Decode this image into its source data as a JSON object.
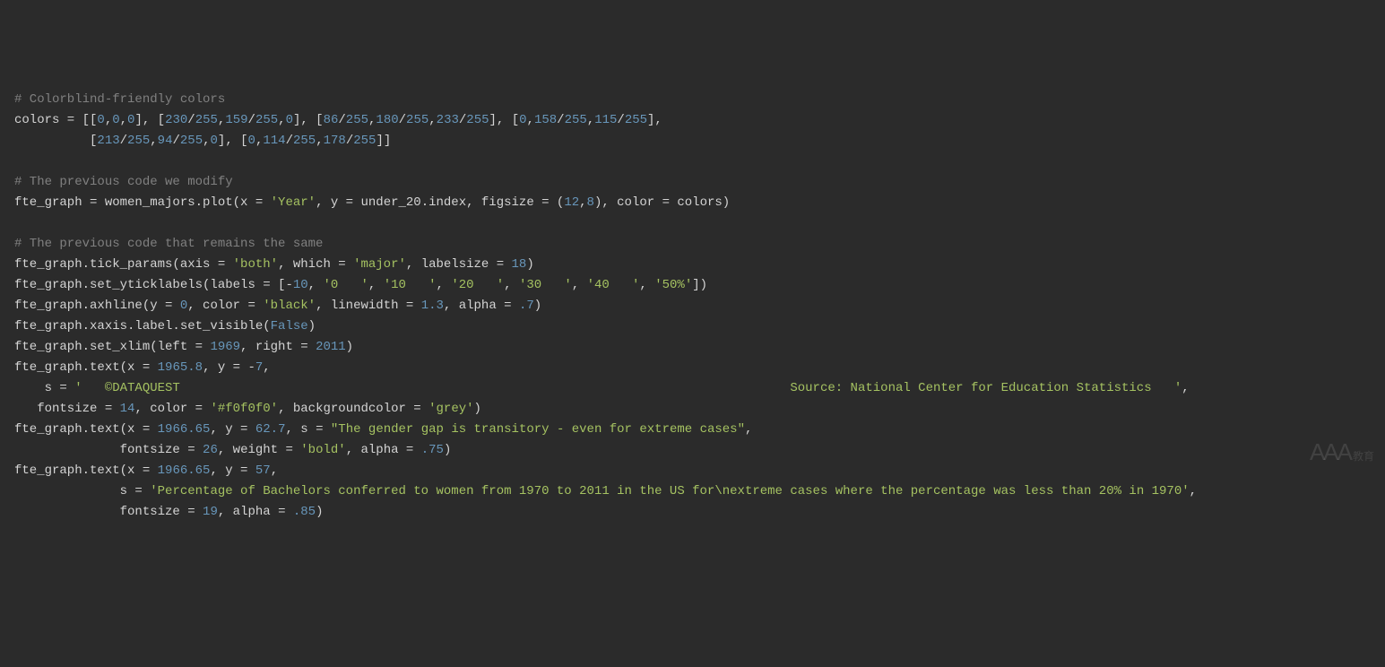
{
  "code": {
    "lines": [
      {
        "type": "comment",
        "text": "# Colorblind-friendly colors"
      },
      {
        "type": "colors_line1",
        "prefix": "colors = [[",
        "n0a": "0",
        "c": ",",
        "n0b": "0",
        "n0c": "0",
        "close": "], [",
        "n1a": "230",
        "slash": "/",
        "n255": "255",
        "n1b": "159",
        "n1c": "0",
        "n2a": "86",
        "n2b": "180",
        "n2c": "233",
        "n3a": "0",
        "n3b": "158",
        "n3c": "115",
        "tail": "],"
      },
      {
        "type": "colors_line2",
        "pad": "          [",
        "n4a": "213",
        "n4b": "94",
        "n4c": "0",
        "n5a": "0",
        "n5b": "114",
        "n5c": "178",
        "tail": "]]"
      },
      {
        "type": "blank"
      },
      {
        "type": "comment",
        "text": "# The previous code we modify"
      },
      {
        "type": "plot_line",
        "prefix": "fte_graph = women_majors.plot(x = ",
        "s1": "'Year'",
        "mid1": ", y = under_20.index, figsize = (",
        "n1": "12",
        "c": ",",
        "n2": "8",
        "mid2": "), color = colors)"
      },
      {
        "type": "blank"
      },
      {
        "type": "comment",
        "text": "# The previous code that remains the same"
      },
      {
        "type": "tick_params",
        "prefix": "fte_graph.tick_params(axis = ",
        "s1": "'both'",
        "mid1": ", which = ",
        "s2": "'major'",
        "mid2": ", labelsize = ",
        "n1": "18",
        "tail": ")"
      },
      {
        "type": "yticklabels",
        "prefix": "fte_graph.set_yticklabels(labels = [-",
        "n0": "10",
        "c": ", ",
        "s1": "'0   '",
        "s2": "'10   '",
        "s3": "'20   '",
        "s4": "'30   '",
        "s5": "'40   '",
        "s6": "'50%'",
        "tail": "])"
      },
      {
        "type": "axhline",
        "prefix": "fte_graph.axhline(y = ",
        "n1": "0",
        "mid1": ", color = ",
        "s1": "'black'",
        "mid2": ", linewidth = ",
        "n2": "1.3",
        "mid3": ", alpha = ",
        "n3": ".7",
        "tail": ")"
      },
      {
        "type": "xaxis_vis",
        "prefix": "fte_graph.xaxis.label.set_visible(",
        "b": "False",
        "tail": ")"
      },
      {
        "type": "xlim",
        "prefix": "fte_graph.set_xlim(left = ",
        "n1": "1969",
        "mid": ", right = ",
        "n2": "2011",
        "tail": ")"
      },
      {
        "type": "text1a",
        "prefix": "fte_graph.text(x = ",
        "n1": "1965.8",
        "mid": ", y = -",
        "n2": "7",
        "tail": ","
      },
      {
        "type": "text1b",
        "pad": "    s = ",
        "s": "'   ©DATAQUEST                                                                                 Source: National Center for Education Statistics   '",
        "tail": ","
      },
      {
        "type": "text1c",
        "pad": "   fontsize = ",
        "n1": "14",
        "mid1": ", color = ",
        "s1": "'#f0f0f0'",
        "mid2": ", backgroundcolor = ",
        "s2": "'grey'",
        "tail": ")"
      },
      {
        "type": "text2a",
        "prefix": "fte_graph.text(x = ",
        "n1": "1966.65",
        "mid1": ", y = ",
        "n2": "62.7",
        "mid2": ", s = ",
        "s1": "\"The gender gap is transitory - even for extreme cases\"",
        "tail": ","
      },
      {
        "type": "text2b",
        "pad": "              fontsize = ",
        "n1": "26",
        "mid1": ", weight = ",
        "s1": "'bold'",
        "mid2": ", alpha = ",
        "n2": ".75",
        "tail": ")"
      },
      {
        "type": "text3a",
        "prefix": "fte_graph.text(x = ",
        "n1": "1966.65",
        "mid1": ", y = ",
        "n2": "57",
        "tail": ","
      },
      {
        "type": "text3b",
        "pad": "              s = ",
        "s": "'Percentage of Bachelors conferred to women from 1970 to 2011 in the US for\\nextreme cases where the percentage was less than 20% in 1970'",
        "tail": ","
      },
      {
        "type": "text3c",
        "pad": "              fontsize = ",
        "n1": "19",
        "mid": ", alpha = ",
        "n2": ".85",
        "tail": ")"
      }
    ]
  },
  "watermark": {
    "main": "AAA",
    "sub": "教育"
  }
}
